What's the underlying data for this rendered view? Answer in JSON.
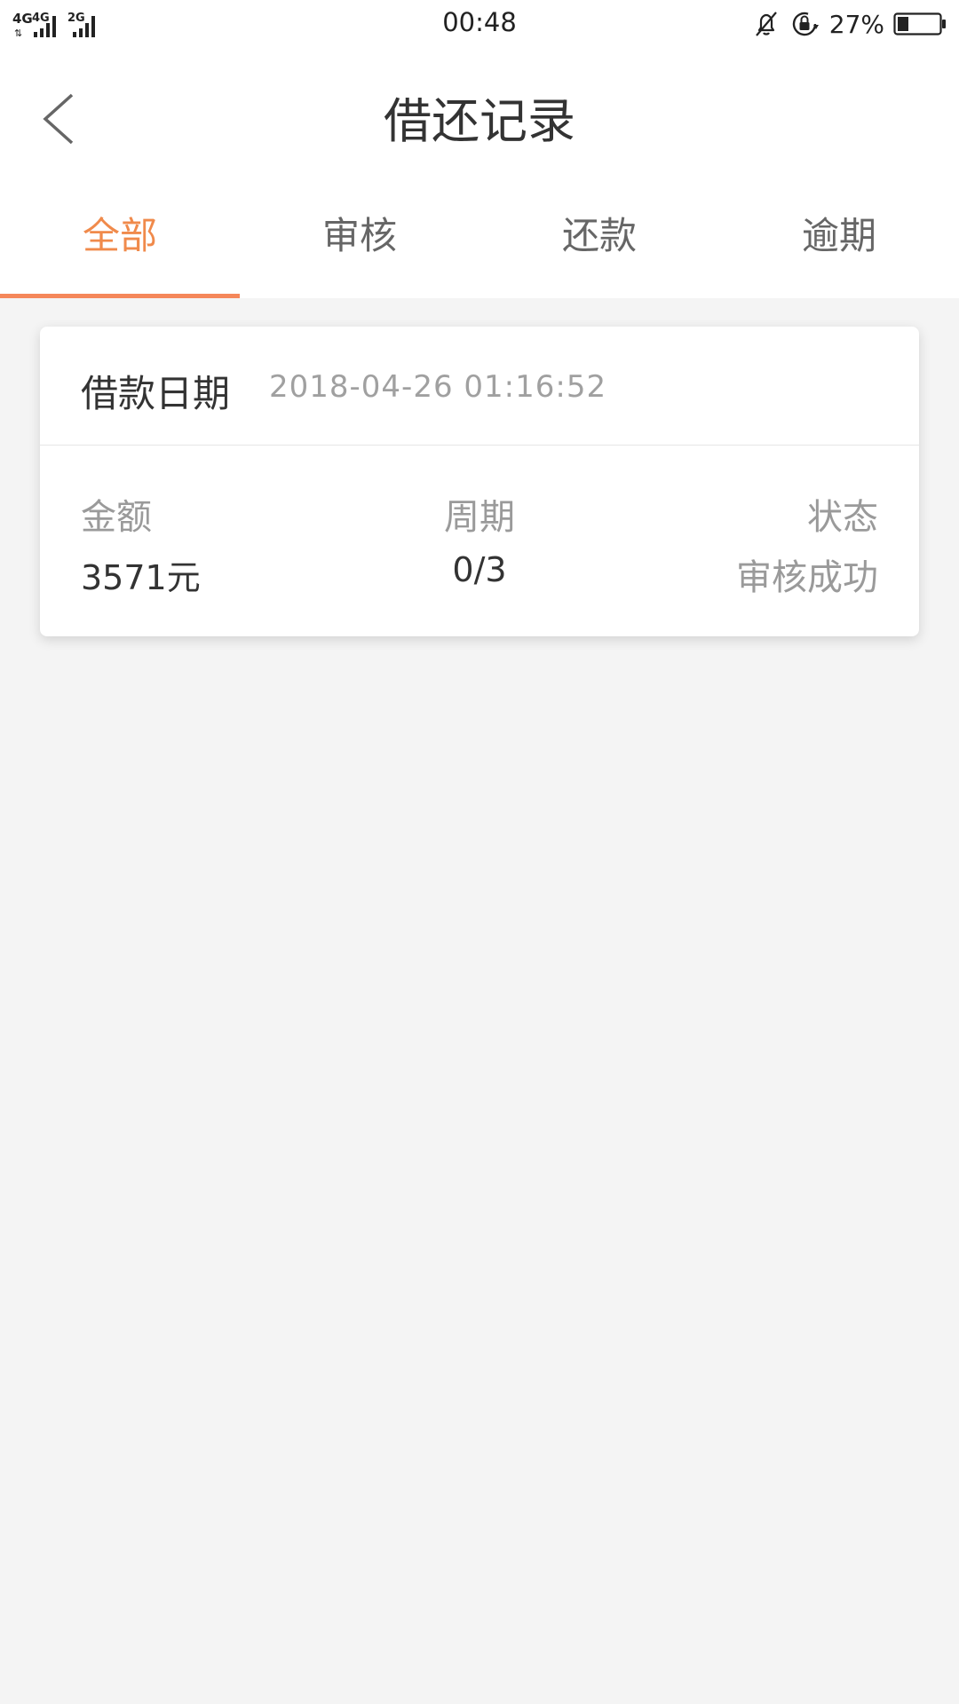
{
  "status_bar": {
    "network1": "4G",
    "network2": "4G",
    "network3": "2G",
    "time": "00:48",
    "battery": "27%",
    "icons": [
      "mute-bell-icon",
      "rotation-lock-icon",
      "battery-icon"
    ]
  },
  "nav": {
    "title": "借还记录",
    "back_icon": "chevron-left-icon"
  },
  "tabs": [
    {
      "label": "全部",
      "active": true
    },
    {
      "label": "审核",
      "active": false
    },
    {
      "label": "还款",
      "active": false
    },
    {
      "label": "逾期",
      "active": false
    }
  ],
  "colors": {
    "accent": "#f08a4b",
    "underline": "#f5875a",
    "background": "#f4f4f4"
  },
  "record": {
    "date_label": "借款日期",
    "date_value": "2018-04-26 01:16:52",
    "amount_label": "金额",
    "amount_value": "3571元",
    "period_label": "周期",
    "period_value": "0/3",
    "status_label": "状态",
    "status_value": "审核成功"
  }
}
